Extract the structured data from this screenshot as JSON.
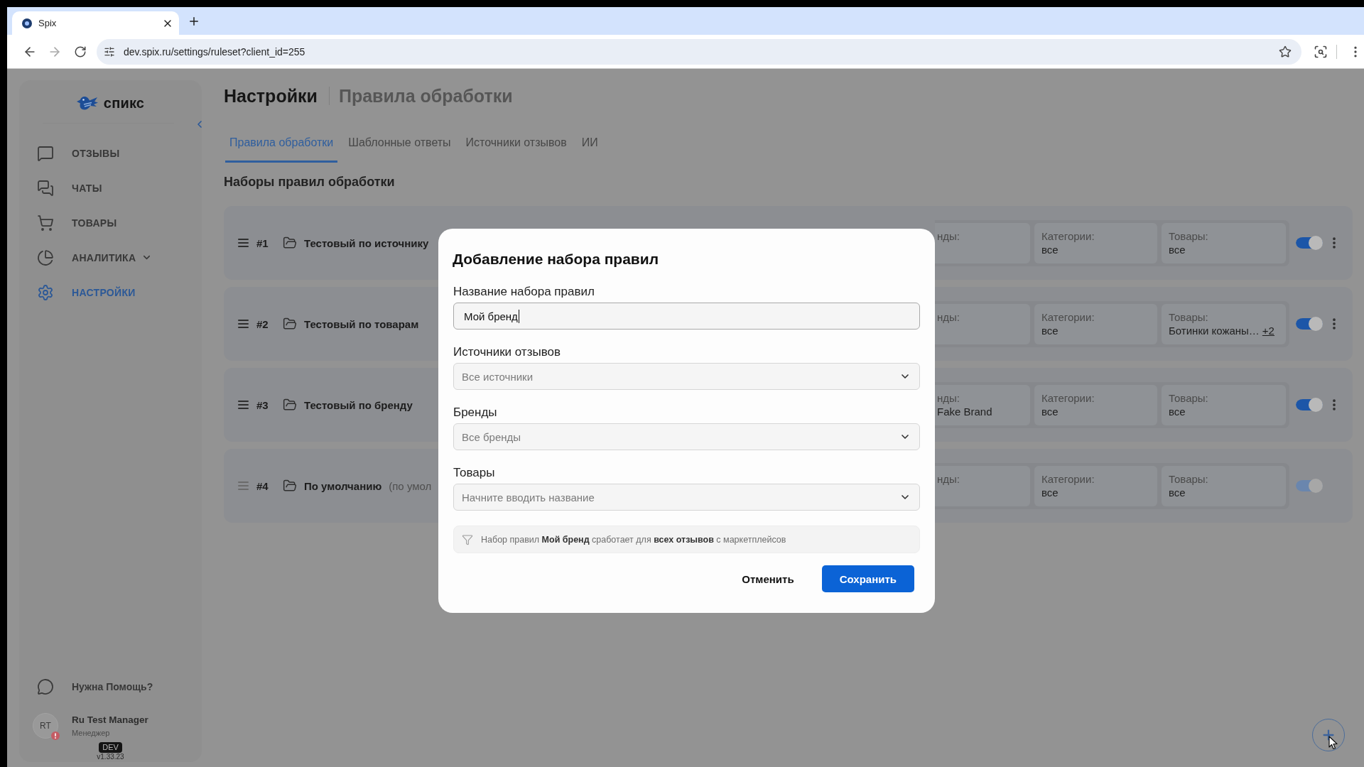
{
  "browser": {
    "tab_title": "Spix",
    "url": "dev.spix.ru/settings/ruleset?client_id=255"
  },
  "sidebar": {
    "logo": "спикс",
    "items": [
      {
        "label": "ОТЗЫВЫ",
        "kind": "link",
        "selected": false
      },
      {
        "label": "ЧАТЫ",
        "kind": "link",
        "selected": false
      },
      {
        "label": "ТОВАРЫ",
        "kind": "link",
        "selected": false
      },
      {
        "label": "АНАЛИТИКА",
        "kind": "group",
        "selected": false,
        "expanded": false
      },
      {
        "label": "НАСТРОЙКИ",
        "kind": "link",
        "selected": true
      }
    ],
    "help": "Нужна Помощь?",
    "user": {
      "initials": "RT",
      "name": "Ru Test Manager",
      "role": "Менеджер",
      "alert": true
    },
    "env": "DEV",
    "version": "v1.33.23"
  },
  "header": {
    "title": "Настройки",
    "subtitle": "Правила обработки"
  },
  "tabs": [
    {
      "label": "Правила обработки",
      "selected": true
    },
    {
      "label": "Шаблонные ответы",
      "selected": false
    },
    {
      "label": "Источники отзывов",
      "selected": false
    },
    {
      "label": "ИИ",
      "selected": false
    }
  ],
  "section_title": "Наборы правил обработки",
  "rulesets": [
    {
      "number": "#1",
      "name": "Тестовый по источнику",
      "brands": {
        "label": "нды:"
      },
      "categories": {
        "label": "Категории:",
        "value": "все"
      },
      "products": {
        "label": "Товары:",
        "value": "все"
      },
      "enabled": true,
      "locked": false
    },
    {
      "number": "#2",
      "name": "Тестовый по товарам",
      "brands": {
        "label": "нды:"
      },
      "categories": {
        "label": "Категории:",
        "value": "все"
      },
      "products": {
        "label": "Товары:",
        "value": "Ботинки кожаны…",
        "more": "+2"
      },
      "enabled": true,
      "locked": false
    },
    {
      "number": "#3",
      "name": "Тестовый по бренду",
      "brands": {
        "label": "нды:",
        "value": "Fake Brand"
      },
      "categories": {
        "label": "Категории:",
        "value": "все"
      },
      "products": {
        "label": "Товары:",
        "value": "все"
      },
      "enabled": true,
      "locked": false
    },
    {
      "number": "#4",
      "name": "По умолчанию",
      "note": "(по умол",
      "brands": {
        "label": "нды:"
      },
      "categories": {
        "label": "Категории:",
        "value": "все"
      },
      "products": {
        "label": "Товары:",
        "value": "все"
      },
      "enabled": true,
      "locked": true
    }
  ],
  "modal": {
    "title": "Добавление набора правил",
    "fields": [
      {
        "kind": "text",
        "label": "Название набора правил",
        "value": "Мой бренд",
        "focused": true
      },
      {
        "kind": "select",
        "label": "Источники отзывов",
        "placeholder": "Все источники"
      },
      {
        "kind": "select",
        "label": "Бренды",
        "placeholder": "Все бренды"
      },
      {
        "kind": "select",
        "label": "Товары",
        "placeholder": "Начните вводить название"
      }
    ],
    "hint": "Набор правил **Мой бренд** сработает для **всех отзывов** с маркетплейсов",
    "buttons": [
      {
        "label": "Отменить",
        "kind": "cancel"
      },
      {
        "label": "Сохранить",
        "kind": "save"
      }
    ]
  }
}
